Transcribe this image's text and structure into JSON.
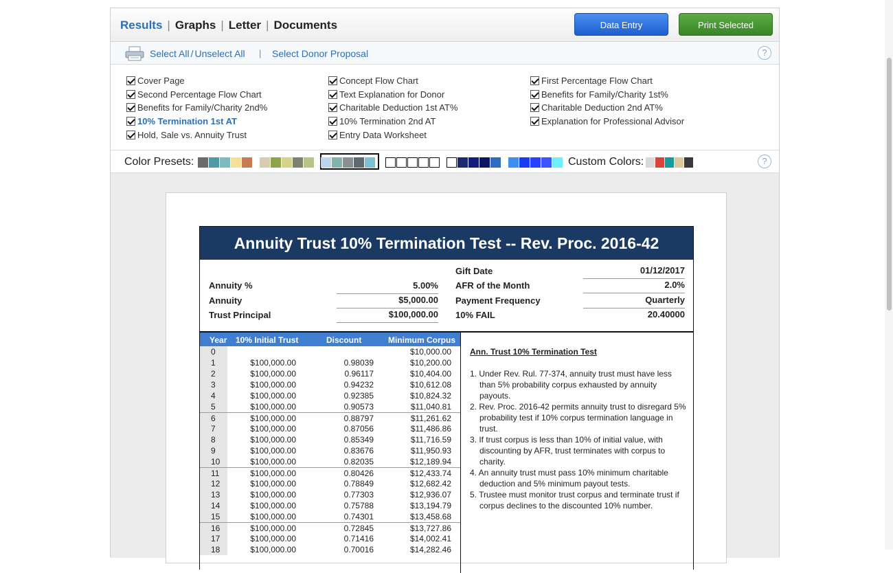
{
  "tabs": [
    {
      "label": "Results",
      "active": true
    },
    {
      "label": "Graphs"
    },
    {
      "label": "Letter"
    },
    {
      "label": "Documents"
    }
  ],
  "tab_separator": "|",
  "buttons": {
    "data_entry": "Data Entry",
    "print_selected": "Print Selected"
  },
  "select_bar": {
    "select_all": "Select All",
    "slash": "/",
    "unselect_all": "Unselect All",
    "pipe": "|",
    "select_donor": "Select Donor Proposal",
    "help": "?"
  },
  "checks": [
    [
      {
        "label": "Cover Page"
      },
      {
        "label": "Second Percentage Flow Chart"
      },
      {
        "label": "Benefits for Family/Charity 2nd%"
      },
      {
        "label": "10% Termination 1st AT",
        "highlighted": true
      },
      {
        "label": "Hold, Sale vs. Annuity Trust"
      }
    ],
    [
      {
        "label": "Concept Flow Chart"
      },
      {
        "label": "Text Explanation for Donor"
      },
      {
        "label": "Charitable Deduction 1st AT%"
      },
      {
        "label": "10% Termination 2nd AT"
      },
      {
        "label": "Entry Data Worksheet"
      }
    ],
    [
      {
        "label": "First Percentage Flow Chart"
      },
      {
        "label": "Benefits for Family/Charity 1st%"
      },
      {
        "label": "Charitable Deduction 2nd AT%"
      },
      {
        "label": "Explanation for Professional Advisor"
      }
    ]
  ],
  "colors": {
    "presets_label": "Color Presets:",
    "custom_label": "Custom Colors:",
    "help": "?",
    "groups": [
      [
        "#6b6b6b",
        "#4f9aa6",
        "#7fbac0",
        "#f3e19a",
        "#c87a55"
      ],
      [
        "#d8ccb0",
        "#8fa44a",
        "#d5d28b",
        "#7c8470",
        "#b5c58a"
      ],
      [
        "#bcd5f0",
        "#7eb4ac",
        "#889090",
        "#5d6a70",
        "#7cc0d8"
      ],
      [
        "#ffffff",
        "#ffffff",
        "#ffffff",
        "#ffffff",
        "#ffffff"
      ],
      [
        "#ffffff",
        "#1a2a6e",
        "#121c7a",
        "#0a1660",
        "#2f6cc0"
      ],
      [
        "#3d8ef0",
        "#1a3cf0",
        "#2a40ff",
        "#3a55ff",
        "#6ff0ff"
      ]
    ],
    "custom": [
      "#d9d9d9",
      "#d8443c",
      "#1a9a9a",
      "#dcc8a0",
      "#3a3a3a"
    ]
  },
  "report": {
    "title": "Annuity Trust 10% Termination Test -- Rev. Proc. 2016-42",
    "left_fields": [
      {
        "label": "Annuity %",
        "value": "5.00%"
      },
      {
        "label": "Annuity",
        "value": "$5,000.00"
      },
      {
        "label": "Trust Principal",
        "value": "$100,000.00"
      }
    ],
    "right_fields": [
      {
        "label": "Gift Date",
        "value": "01/12/2017"
      },
      {
        "label": "AFR of the Month",
        "value": "2.0%"
      },
      {
        "label": "Payment Frequency",
        "value": "Quarterly"
      },
      {
        "label": "10% FAIL",
        "value": "20.40000"
      }
    ],
    "table_headers": [
      "Year",
      "10% Initial Trust",
      "Discount",
      "Minimum Corpus"
    ],
    "rows": [
      [
        "0",
        "",
        "",
        "$10,000.00"
      ],
      [
        "1",
        "$100,000.00",
        "0.98039",
        "$10,200.00"
      ],
      [
        "2",
        "$100,000.00",
        "0.96117",
        "$10,404.00"
      ],
      [
        "3",
        "$100,000.00",
        "0.94232",
        "$10,612.08"
      ],
      [
        "4",
        "$100,000.00",
        "0.92385",
        "$10,824.32"
      ],
      [
        "5",
        "$100,000.00",
        "0.90573",
        "$11,040.81"
      ],
      [
        "6",
        "$100,000.00",
        "0.88797",
        "$11,261.62"
      ],
      [
        "7",
        "$100,000.00",
        "0.87056",
        "$11,486.86"
      ],
      [
        "8",
        "$100,000.00",
        "0.85349",
        "$11,716.59"
      ],
      [
        "9",
        "$100,000.00",
        "0.83676",
        "$11,950.93"
      ],
      [
        "10",
        "$100,000.00",
        "0.82035",
        "$12,189.94"
      ],
      [
        "11",
        "$100,000.00",
        "0.80426",
        "$12,433.74"
      ],
      [
        "12",
        "$100,000.00",
        "0.78849",
        "$12,682.42"
      ],
      [
        "13",
        "$100,000.00",
        "0.77303",
        "$12,936.07"
      ],
      [
        "14",
        "$100,000.00",
        "0.75788",
        "$13,194.79"
      ],
      [
        "15",
        "$100,000.00",
        "0.74301",
        "$13,458.68"
      ],
      [
        "16",
        "$100,000.00",
        "0.72845",
        "$13,727.86"
      ],
      [
        "17",
        "$100,000.00",
        "0.71416",
        "$14,002.41"
      ],
      [
        "18",
        "$100,000.00",
        "0.70016",
        "$14,282.46"
      ]
    ],
    "notes_title": "Ann. Trust 10% Termination Test",
    "notes": [
      "1. Under Rev. Rul. 77-374, annuity trust must have less than 5% probability corpus exhausted by annuity payouts.",
      "2. Rev. Proc. 2016-42 permits annuity trust to disregard 5% probability test if 10% corpus termination language in trust.",
      "3. If trust corpus is less than 10% of initial value, with discounting by AFR, trust terminates with corpus to charity.",
      "4. An annuity trust must pass 10% minimum charitable deduction and 5% minimum payout tests.",
      "5. Trustee must monitor trust corpus and terminate trust if corpus declines to the discounted 10% number."
    ]
  }
}
